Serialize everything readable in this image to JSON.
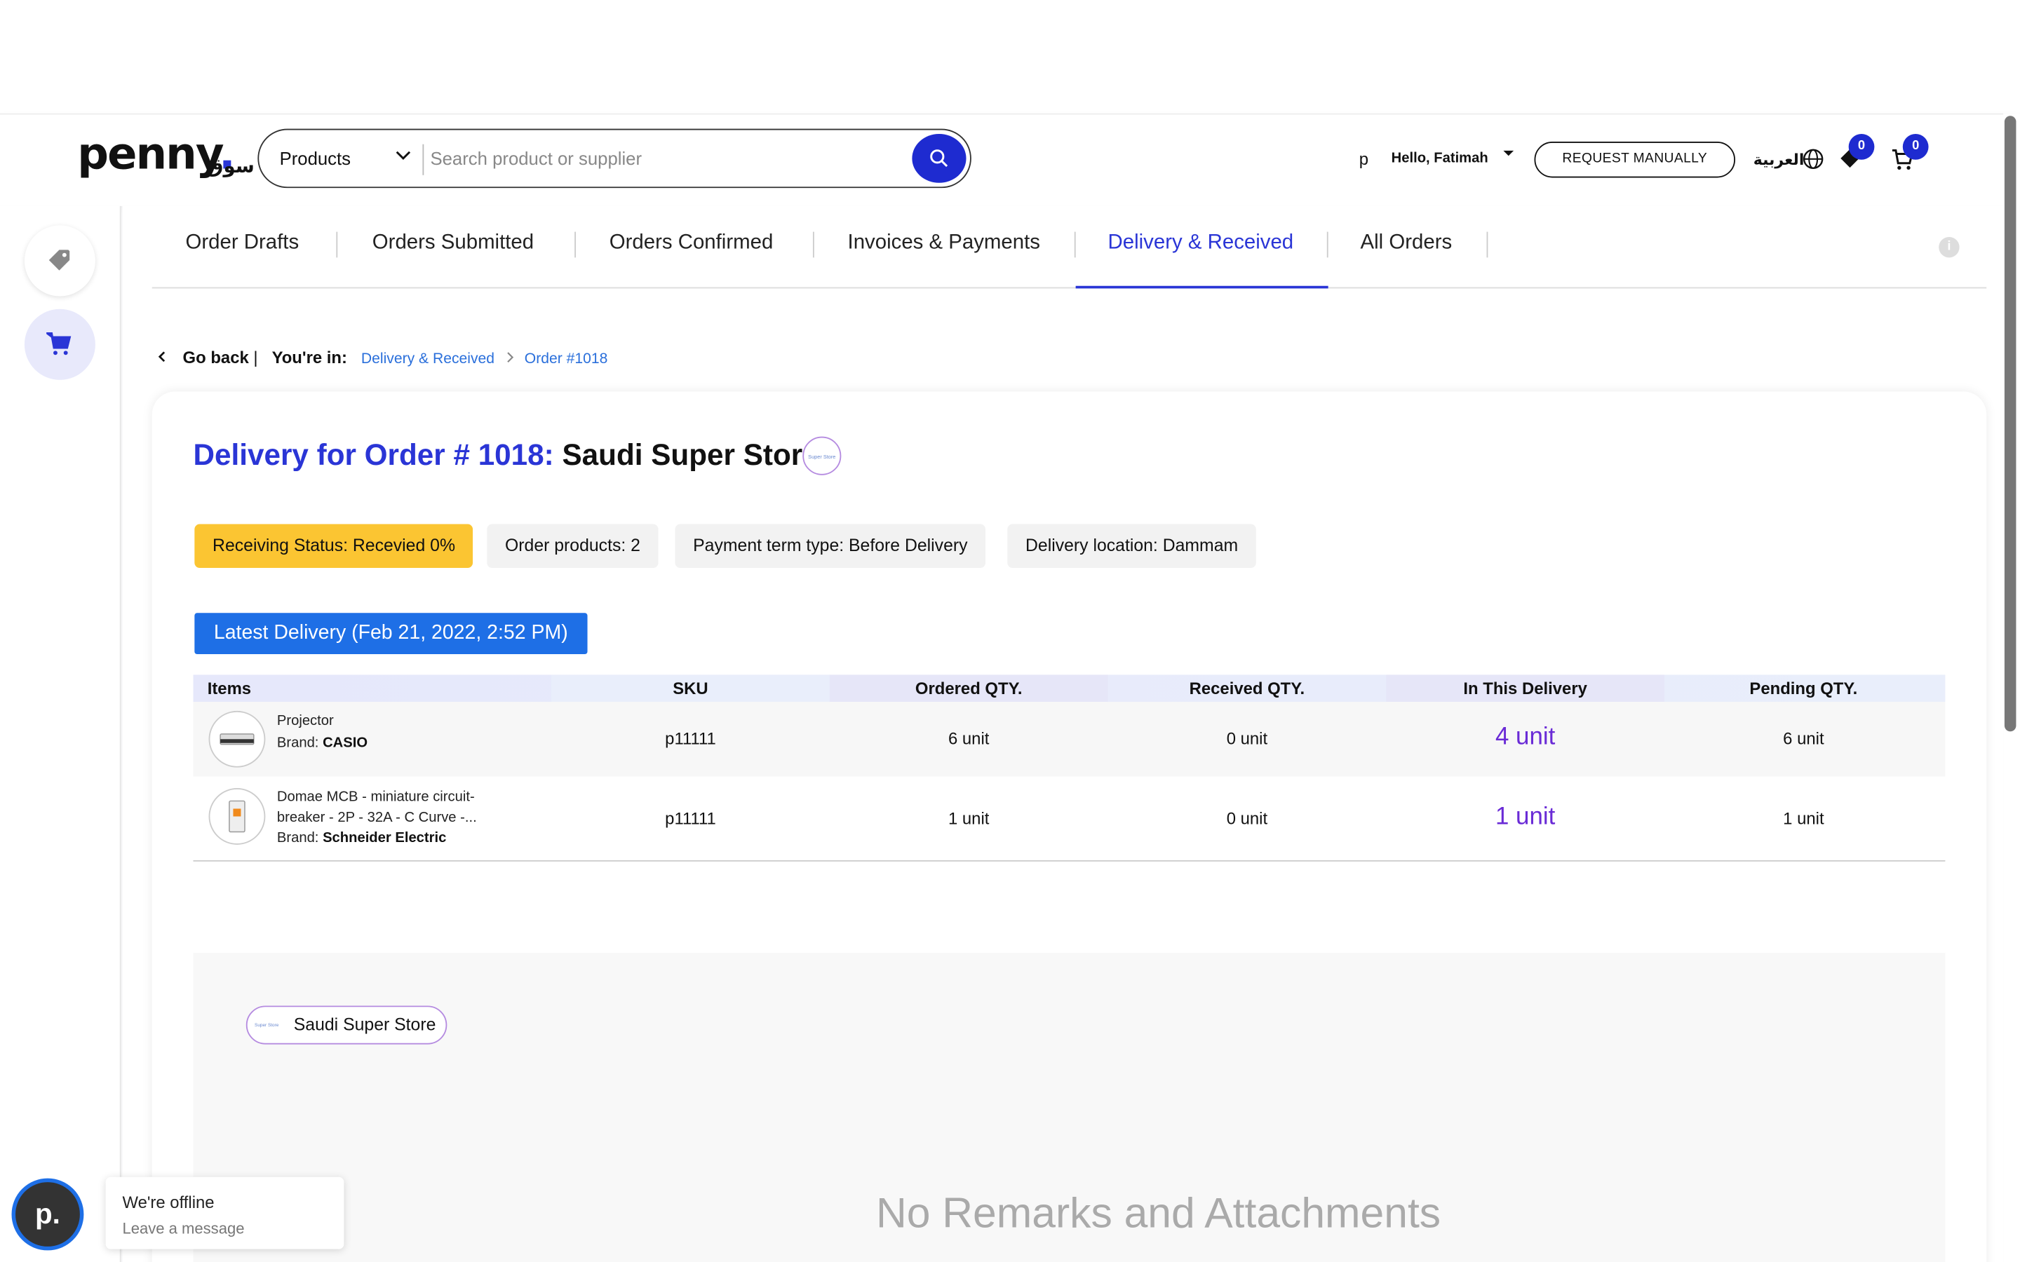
{
  "header": {
    "logo_text": "penny",
    "logo_ar": "سوق",
    "category_select": "Products",
    "search_placeholder": "Search product or supplier",
    "user_initial": "p",
    "greeting": "Hello, Fatimah",
    "request_button": "REQUEST MANUALLY",
    "language": "العربية",
    "wishlist_count": "0",
    "cart_count": "0"
  },
  "sidebar": {
    "items": [
      {
        "icon": "tag-icon",
        "active": false
      },
      {
        "icon": "cart-icon",
        "active": true
      }
    ]
  },
  "tabs": [
    {
      "label": "Order Drafts",
      "active": false
    },
    {
      "label": "Orders Submitted",
      "active": false
    },
    {
      "label": "Orders Confirmed",
      "active": false
    },
    {
      "label": "Invoices & Payments",
      "active": false
    },
    {
      "label": "Delivery & Received",
      "active": true
    },
    {
      "label": "All Orders",
      "active": false
    }
  ],
  "breadcrumb": {
    "back": "Go back",
    "sep": "|",
    "youre_in": "You're in:",
    "items": [
      "Delivery & Received",
      "Order #1018"
    ]
  },
  "order": {
    "title_prefix": "Delivery for Order # 1018:",
    "store": "Saudi Super Store",
    "store_logo_text": "Super Store",
    "chips": [
      "Receiving Status: Recevied 0%",
      "Order products: 2",
      "Payment term type: Before Delivery",
      "Delivery location: Dammam"
    ],
    "latest_delivery": "Latest Delivery (Feb 21, 2022, 2:52 PM)"
  },
  "table": {
    "headers": [
      "Items",
      "SKU",
      "Ordered QTY.",
      "Received QTY.",
      "In This Delivery",
      "Pending QTY."
    ],
    "rows": [
      {
        "name": "Projector",
        "brand_label": "Brand:",
        "brand": "CASIO",
        "sku": "p11111",
        "ordered": "6 unit",
        "received": "0 unit",
        "in_delivery": "4 unit",
        "pending": "6 unit"
      },
      {
        "name_line1": "Domae MCB - miniature circuit-",
        "name_line2": "breaker - 2P - 32A - C Curve -...",
        "brand_label": "Brand:",
        "brand": "Schneider Electric",
        "sku": "p11111",
        "ordered": "1 unit",
        "received": "0 unit",
        "in_delivery": "1 unit",
        "pending": "1 unit"
      }
    ]
  },
  "remarks": {
    "store_pill": "Saudi Super Store",
    "empty_text": "No Remarks and Attachments"
  },
  "chat": {
    "avatar": "p.",
    "status": "We're offline",
    "action": "Leave a message"
  },
  "colors": {
    "brand_blue": "#2a35d6",
    "warning": "#fbc532",
    "delivery_qty": "#6a2bd6",
    "latest_btn": "#1e6fe6"
  }
}
